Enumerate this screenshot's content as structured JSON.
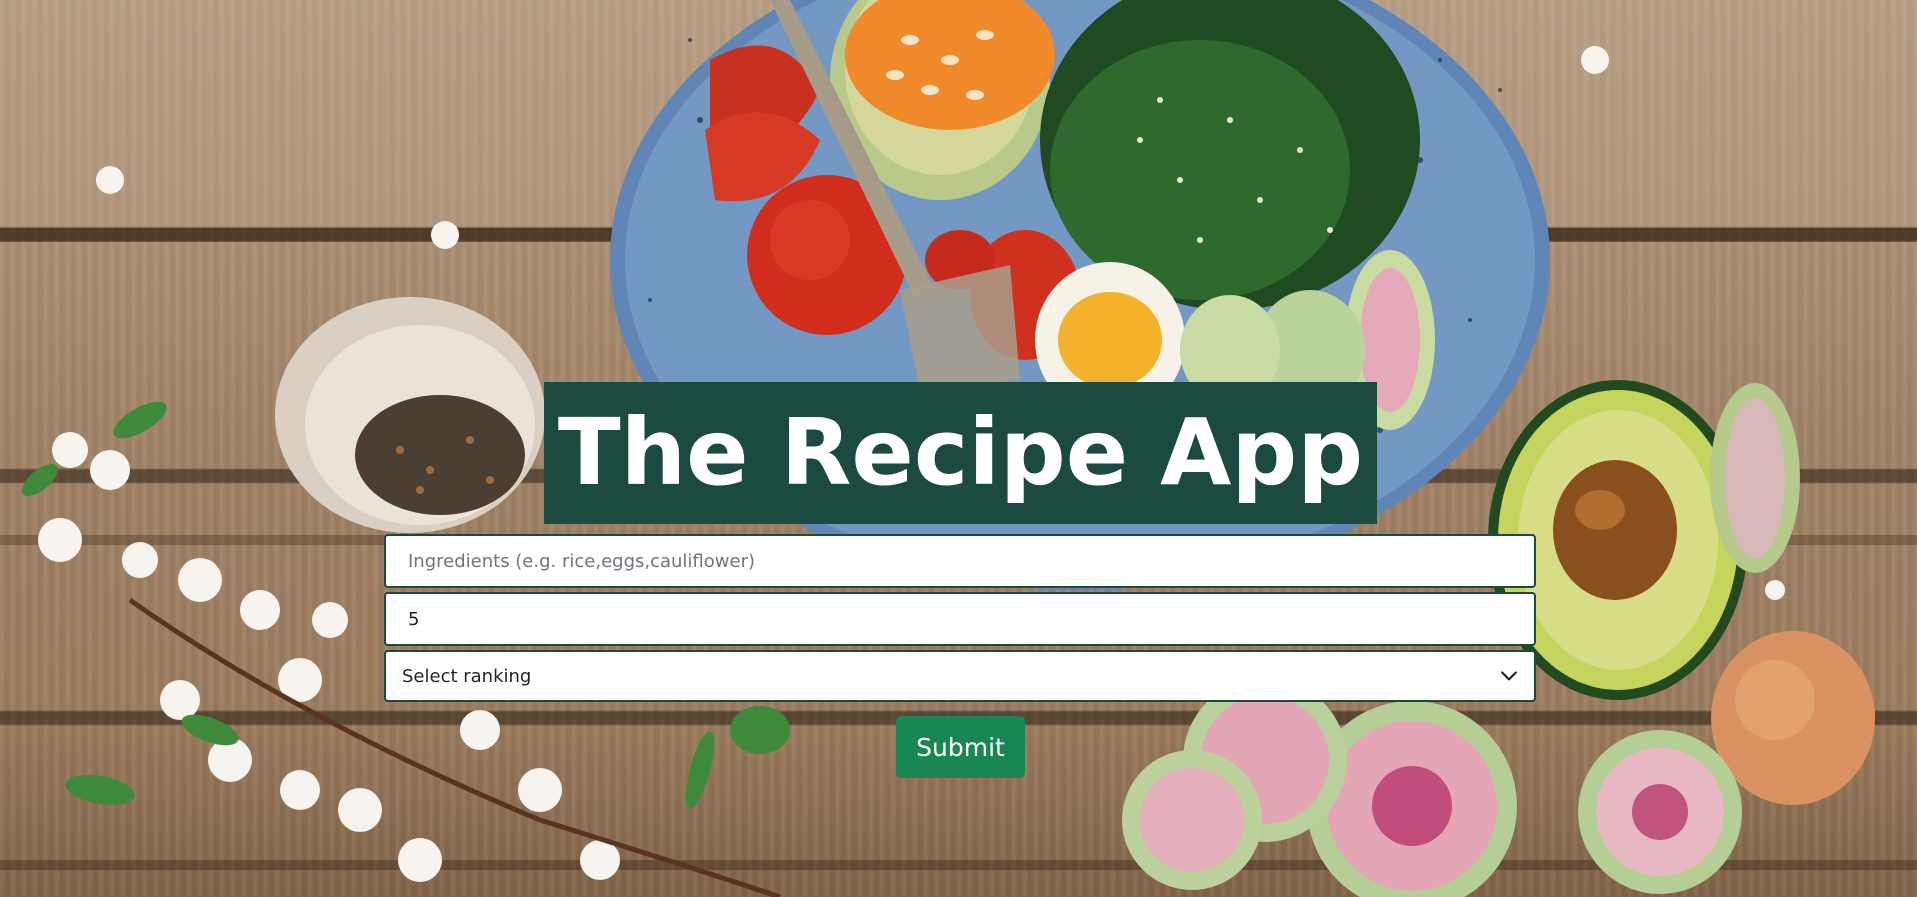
{
  "app": {
    "title": "The Recipe App"
  },
  "form": {
    "ingredients": {
      "value": "",
      "placeholder": "Ingredients (e.g. rice,eggs,cauliflower)"
    },
    "count": {
      "value": "5"
    },
    "ranking": {
      "selected": "Select ranking"
    },
    "submit_label": "Submit"
  },
  "colors": {
    "title_bg": "#1b4a40",
    "field_border": "#1b4a40",
    "submit_bg": "#198754",
    "text_white": "#ffffff"
  },
  "icons": {
    "ranking_dropdown": "chevron-down-icon"
  }
}
